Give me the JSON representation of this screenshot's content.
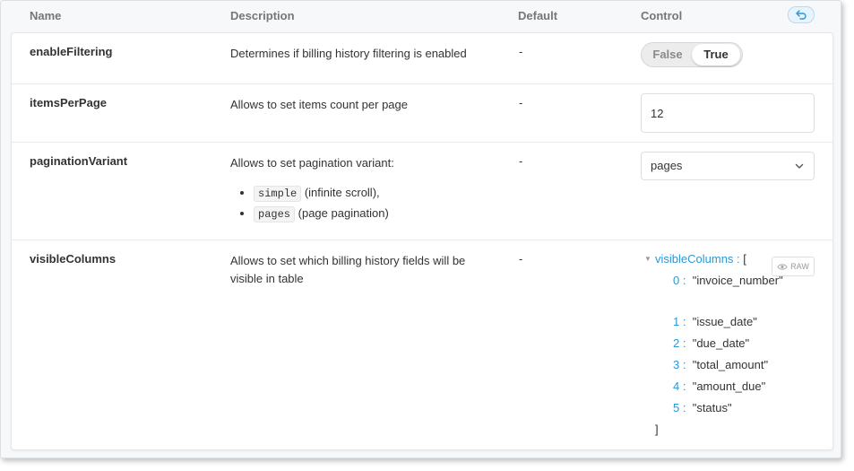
{
  "header": {
    "col_name": "Name",
    "col_description": "Description",
    "col_default": "Default",
    "col_control": "Control"
  },
  "rows": [
    {
      "name": "enableFiltering",
      "description": "Determines if billing history filtering is enabled",
      "default": "-",
      "control": {
        "false_label": "False",
        "true_label": "True",
        "selected": "True"
      }
    },
    {
      "name": "itemsPerPage",
      "description": "Allows to set items count per page",
      "default": "-",
      "control": {
        "value": "12"
      }
    },
    {
      "name": "paginationVariant",
      "description": "Allows to set pagination variant:",
      "options": [
        {
          "code": "simple",
          "text": "(infinite scroll),"
        },
        {
          "code": "pages",
          "text": "(page pagination)"
        }
      ],
      "default": "-",
      "control": {
        "selected": "pages"
      }
    },
    {
      "name": "visibleColumns",
      "description": "Allows to set which billing history fields will be visible in table",
      "default": "-",
      "control": {
        "key": "visibleColumns :",
        "open": "[",
        "close": "]",
        "raw_label": "RAW",
        "items": [
          {
            "index": "0 :",
            "value": "\"invoice_number\""
          },
          {
            "index": "1 :",
            "value": "\"issue_date\""
          },
          {
            "index": "2 :",
            "value": "\"due_date\""
          },
          {
            "index": "3 :",
            "value": "\"total_amount\""
          },
          {
            "index": "4 :",
            "value": "\"amount_due\""
          },
          {
            "index": "5 :",
            "value": "\"status\""
          }
        ]
      }
    }
  ],
  "colors": {
    "accent": "#2a98d8",
    "header_text": "#767676"
  },
  "icons": {
    "reset": "undo-arrow-icon",
    "chevron": "chevron-down-icon",
    "raw": "eye-icon"
  }
}
